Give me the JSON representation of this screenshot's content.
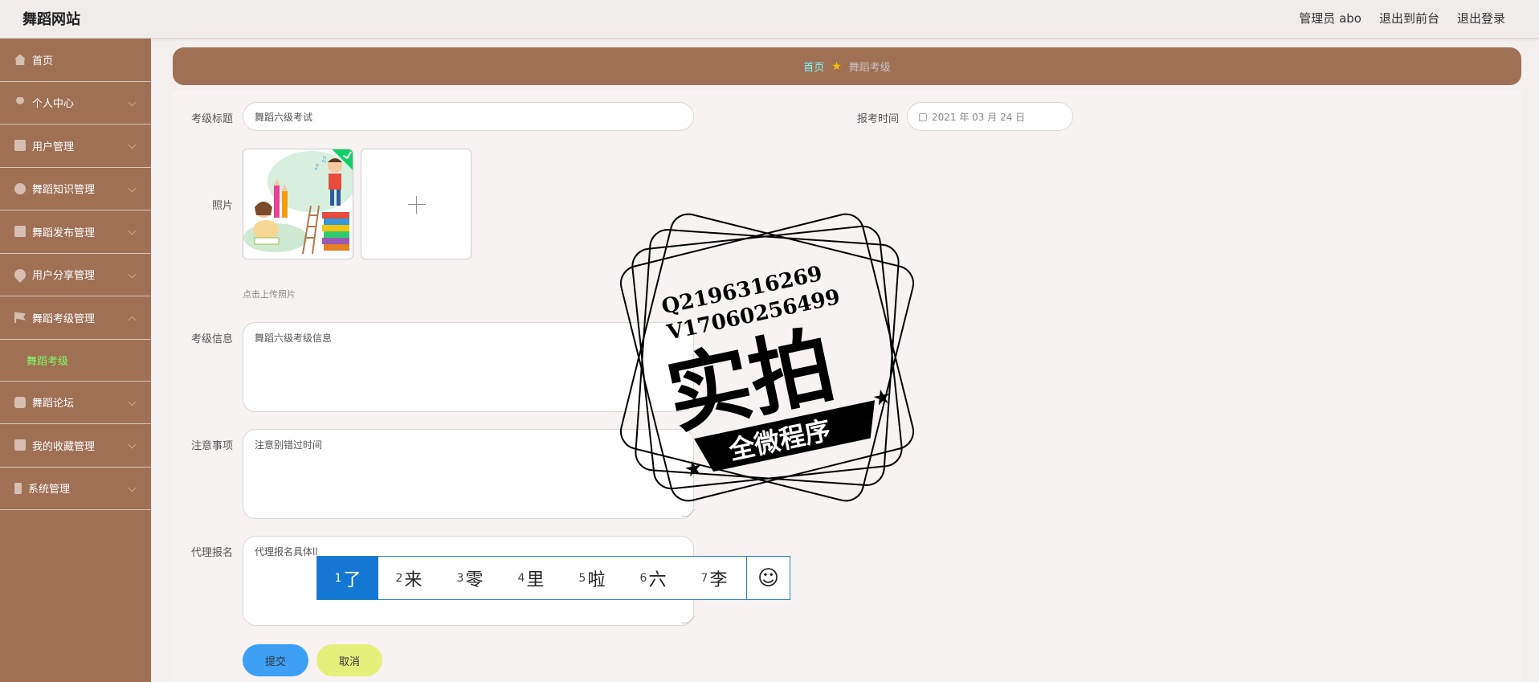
{
  "header": {
    "site_title": "舞蹈网站",
    "admin_user": "管理员 abo",
    "to_front": "退出到前台",
    "logout": "退出登录"
  },
  "sidebar": {
    "items": [
      {
        "label": "首页",
        "icon": "home-icon"
      },
      {
        "label": "个人中心",
        "icon": "user-icon"
      },
      {
        "label": "用户管理",
        "icon": "clipboard-icon"
      },
      {
        "label": "舞蹈知识管理",
        "icon": "dashboard-icon"
      },
      {
        "label": "舞蹈发布管理",
        "icon": "briefcase-icon"
      },
      {
        "label": "用户分享管理",
        "icon": "pin-icon"
      },
      {
        "label": "舞蹈考级管理",
        "icon": "flag-icon"
      },
      {
        "label": "舞蹈论坛",
        "icon": "chat-icon"
      },
      {
        "label": "我的收藏管理",
        "icon": "clipboard-icon"
      },
      {
        "label": "系统管理",
        "icon": "phone-icon"
      }
    ],
    "active_sub": "舞蹈考级"
  },
  "breadcrumb": {
    "home": "首页",
    "current": "舞蹈考级"
  },
  "form": {
    "title_label": "考级标题",
    "title_value": "舞蹈六级考试",
    "date_label": "报考时间",
    "date_value": "2021 年 03 月 24 日",
    "photo_label": "照片",
    "upload_tip": "点击上传照片",
    "info_label": "考级信息",
    "info_value": "舞蹈六级考级信息",
    "notes_label": "注意事项",
    "notes_value": "注意别错过时间",
    "proxy_label": "代理报名",
    "proxy_value": "代理报名具体ll",
    "submit": "提交",
    "cancel": "取消"
  },
  "ime": {
    "candidates": [
      {
        "n": "1",
        "c": "了"
      },
      {
        "n": "2",
        "c": "来"
      },
      {
        "n": "3",
        "c": "零"
      },
      {
        "n": "4",
        "c": "里"
      },
      {
        "n": "5",
        "c": "啦"
      },
      {
        "n": "6",
        "c": "六"
      },
      {
        "n": "7",
        "c": "李"
      }
    ],
    "emoji": "☺"
  },
  "watermark": {
    "line1": "Q2196316269",
    "line2": "V17060256499",
    "big": "实拍",
    "ribbon": "全微程序"
  },
  "colors": {
    "sidebar": "#9f7054",
    "accent_sub": "#7fff6a",
    "breadcrumb_home": "#7df6ff",
    "submit": "#3ea0f5",
    "cancel": "#e3f07c"
  }
}
